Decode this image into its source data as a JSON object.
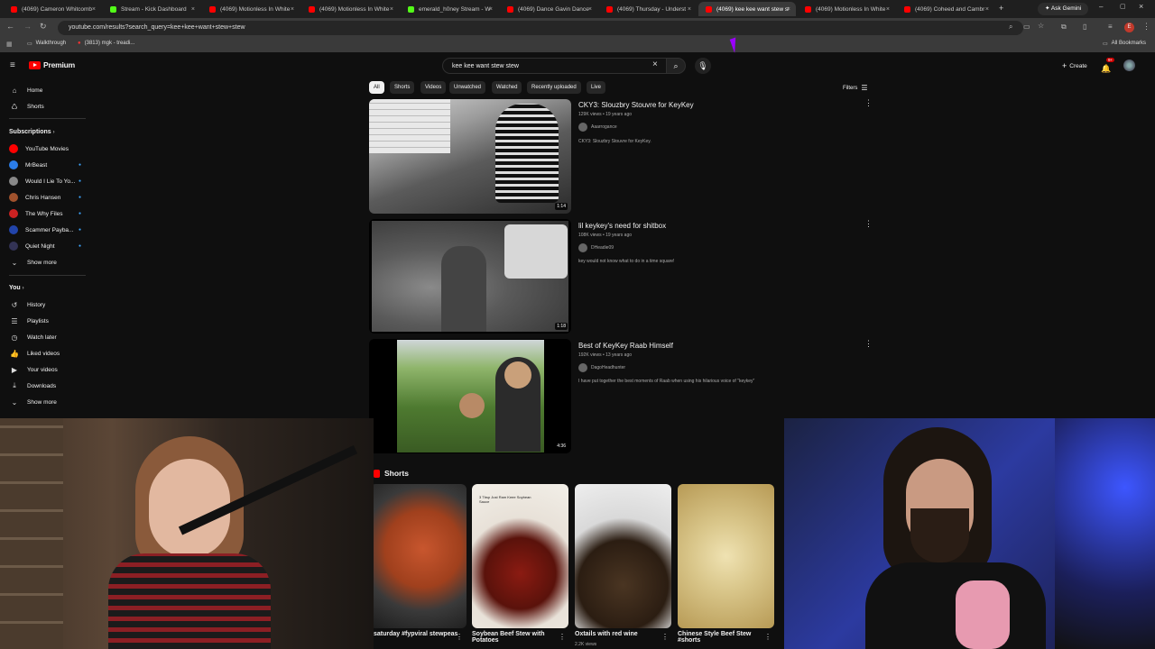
{
  "browser": {
    "tabs": [
      {
        "label": "(4069) Cameron Whitcomb",
        "color": "#ff0000",
        "active": false
      },
      {
        "label": "Stream - Kick Dashboard",
        "color": "#53fc18",
        "active": false
      },
      {
        "label": "(4069) Motionless In White",
        "color": "#ff0000",
        "active": false
      },
      {
        "label": "(4069) Motionless In White",
        "color": "#ff0000",
        "active": false
      },
      {
        "label": "emerald_h0ney Stream - W",
        "color": "#53fc18",
        "active": false
      },
      {
        "label": "(4069) Dance Gavin Dance",
        "color": "#ff0000",
        "active": false
      },
      {
        "label": "(4069) Thursday - Underst",
        "color": "#ff0000",
        "active": false
      },
      {
        "label": "(4069) kee kee want stew st",
        "color": "#ff0000",
        "active": true
      },
      {
        "label": "(4069) Motionless In White",
        "color": "#ff0000",
        "active": false
      },
      {
        "label": "(4069) Coheed and Cambr",
        "color": "#ff0000",
        "active": false
      }
    ],
    "new_tab": "+",
    "ask_gemini": "Ask Gemini",
    "url": "youtube.com/results?search_query=kee+kee+want+stew+stew",
    "bookmarks": [
      {
        "label": "Walkthrough"
      },
      {
        "label": "(3813) mgk - treadi..."
      }
    ],
    "all_bookmarks": "All Bookmarks"
  },
  "youtube": {
    "logo": "Premium",
    "search_value": "kee kee want stew stew",
    "create_label": "Create",
    "notif_count": "9+",
    "sidebar": {
      "home": "Home",
      "shorts": "Shorts",
      "subscriptions_title": "Subscriptions",
      "subscriptions": [
        {
          "label": "YouTube Movies",
          "color": "#ff0000"
        },
        {
          "label": "MrBeast",
          "color": "#2b7de9"
        },
        {
          "label": "Would I Lie To Yo...",
          "color": "#888888"
        },
        {
          "label": "Chris Hansen",
          "color": "#a0522d"
        },
        {
          "label": "The Why Files",
          "color": "#cc2222"
        },
        {
          "label": "Scammer Payba...",
          "color": "#2244aa"
        },
        {
          "label": "Quiet Night",
          "color": "#333355"
        }
      ],
      "show_more": "Show more",
      "you_title": "You",
      "you_items": [
        {
          "label": "History",
          "icon": "history-icon"
        },
        {
          "label": "Playlists",
          "icon": "playlists-icon"
        },
        {
          "label": "Watch later",
          "icon": "clock-icon"
        },
        {
          "label": "Liked videos",
          "icon": "thumbs-up-icon"
        },
        {
          "label": "Your videos",
          "icon": "video-icon"
        },
        {
          "label": "Downloads",
          "icon": "download-icon"
        }
      ],
      "show_more_2": "Show more"
    },
    "chips": [
      "All",
      "Shorts",
      "Videos",
      "Unwatched",
      "Watched",
      "Recently uploaded",
      "Live"
    ],
    "filters": "Filters",
    "results": [
      {
        "title": "CKY3: Slouzbry Stouvre for KeyKey",
        "meta": "129K views • 19 years ago",
        "channel": "Aaarrogance",
        "desc": "CKY3: Slouzbry Stouvre for KeyKey.",
        "duration": "1:14"
      },
      {
        "title": "lil keykey's need for shitbox",
        "meta": "108K views • 19 years ago",
        "channel": "DHeadie09",
        "desc": "key would not know what to do in a time square!",
        "duration": "1:18"
      },
      {
        "title": "Best of KeyKey Raab Himself",
        "meta": "192K views • 13 years ago",
        "channel": "DagoHeadhunter",
        "desc": "I have put together the best moments of Raab when using his hilarious voice of \"keykey\"",
        "duration": "4:36"
      }
    ],
    "shorts_title": "Shorts",
    "shorts": [
      {
        "title": "saturday #fypviral stewpeas",
        "views": ""
      },
      {
        "title": "Soybean Beef Stew with Potatoes",
        "views": ""
      },
      {
        "title": "Oxtails with red wine",
        "views": "2.2K views"
      },
      {
        "title": "Chinese Style Beef Stew #shorts",
        "views": ""
      }
    ],
    "shorts_overlay_text": "3 Tbsp Just Ram Keee Soybean Sauce"
  }
}
